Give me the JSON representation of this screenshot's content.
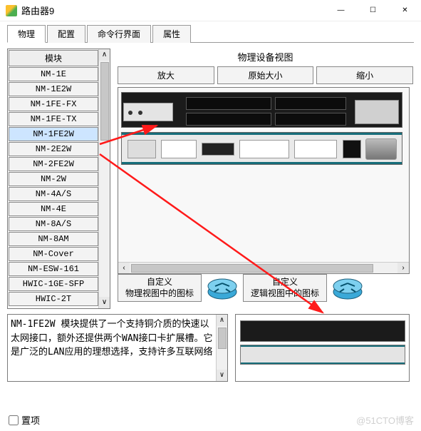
{
  "window": {
    "title": "路由器9",
    "minimize": "—",
    "maximize": "☐",
    "close": "✕"
  },
  "tabs": [
    {
      "label": "物理",
      "active": true
    },
    {
      "label": "配置",
      "active": false
    },
    {
      "label": "命令行界面",
      "active": false
    },
    {
      "label": "属性",
      "active": false
    }
  ],
  "modules": {
    "header": "模块",
    "items": [
      "NM-1E",
      "NM-1E2W",
      "NM-1FE-FX",
      "NM-1FE-TX",
      "NM-1FE2W",
      "NM-2E2W",
      "NM-2FE2W",
      "NM-2W",
      "NM-4A/S",
      "NM-4E",
      "NM-8A/S",
      "NM-8AM",
      "NM-Cover",
      "NM-ESW-161",
      "HWIC-1GE-SFP",
      "HWIC-2T"
    ],
    "selected": "NM-1FE2W"
  },
  "view": {
    "title": "物理设备视图",
    "zoom_in": "放大",
    "zoom_orig": "原始大小",
    "zoom_out": "缩小"
  },
  "custom": {
    "phys_line1": "自定义",
    "phys_line2": "物理视图中的图标",
    "logic_line1": "自定义",
    "logic_line2": "逻辑视图中的图标"
  },
  "description": "NM-1FE2W 模块提供了一个支持铜介质的快速以太网接口，额外还提供两个WAN接口卡扩展槽。它是广泛的LAN应用的理想选择，支持许多互联网络",
  "footer": {
    "checkbox_label": "置项"
  },
  "watermark": "@51CTO博客"
}
